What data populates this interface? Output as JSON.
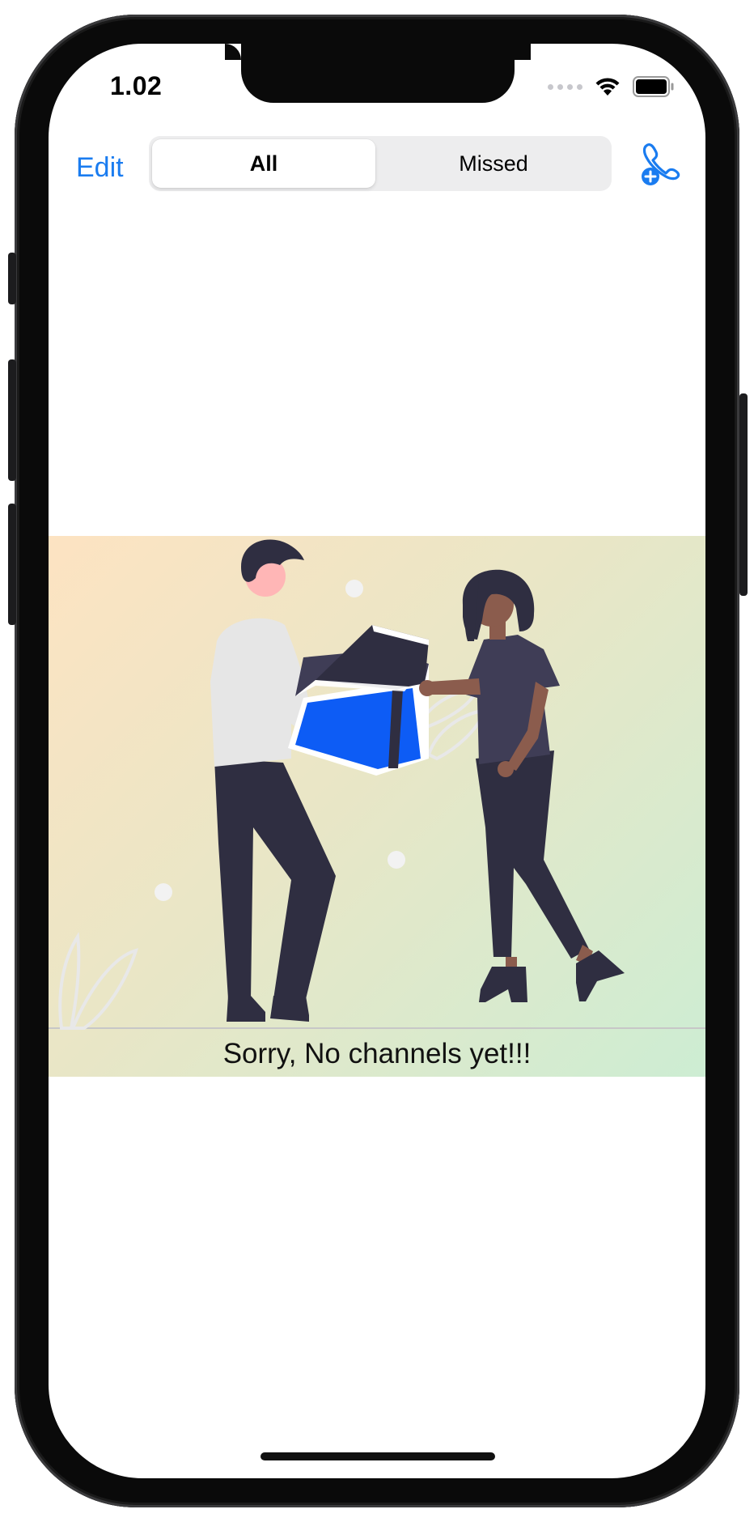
{
  "status_bar": {
    "time": "1.02",
    "icons": [
      "cellular-dots-icon",
      "wifi-icon",
      "battery-icon"
    ]
  },
  "navbar": {
    "edit_label": "Edit",
    "segments": [
      {
        "label": "All",
        "selected": true
      },
      {
        "label": "Missed",
        "selected": false
      }
    ],
    "add_call_icon": "add-call-icon"
  },
  "empty_state": {
    "message": "Sorry, No channels yet!!!",
    "illustration": "two-people-exchanging-gift-illustration"
  },
  "colors": {
    "accent": "#1a7cf0",
    "gift_blue": "#0d5cf5",
    "dark_clothing": "#2f2e41",
    "segment_bg": "#ededee"
  }
}
